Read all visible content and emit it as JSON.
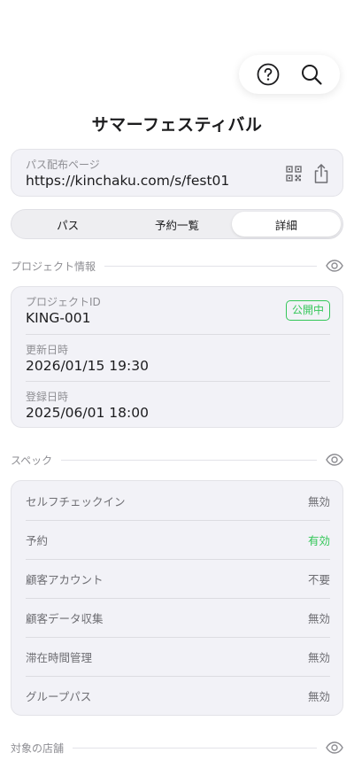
{
  "header": {
    "title": "サマーフェスティバル",
    "help_icon": "help-circle-icon",
    "search_icon": "search-icon"
  },
  "pass_url": {
    "label": "パス配布ページ",
    "value": "https://kinchaku.com/s/fest01"
  },
  "tabs": [
    {
      "label": "パス",
      "active": false
    },
    {
      "label": "予約一覧",
      "active": false
    },
    {
      "label": "詳細",
      "active": true
    }
  ],
  "project_section": {
    "title": "プロジェクト情報",
    "rows": [
      {
        "label": "プロジェクトID",
        "value": "KING-001"
      },
      {
        "label": "更新日時",
        "value": "2026/01/15 19:30"
      },
      {
        "label": "登録日時",
        "value": "2025/06/01 18:00"
      }
    ],
    "status_badge": "公開中"
  },
  "spec_section": {
    "title": "スペック",
    "rows": [
      {
        "label": "セルフチェックイン",
        "value": "無効",
        "enabled": false
      },
      {
        "label": "予約",
        "value": "有効",
        "enabled": true
      },
      {
        "label": "顧客アカウント",
        "value": "不要",
        "enabled": false
      },
      {
        "label": "顧客データ収集",
        "value": "無効",
        "enabled": false
      },
      {
        "label": "滞在時間管理",
        "value": "無効",
        "enabled": false
      },
      {
        "label": "グループパス",
        "value": "無効",
        "enabled": false
      }
    ]
  },
  "stores_section": {
    "title": "対象の店舗"
  },
  "colors": {
    "accent_green": "#34c759",
    "card_bg": "#f2f2f7",
    "secondary_text": "#8e8e93"
  }
}
